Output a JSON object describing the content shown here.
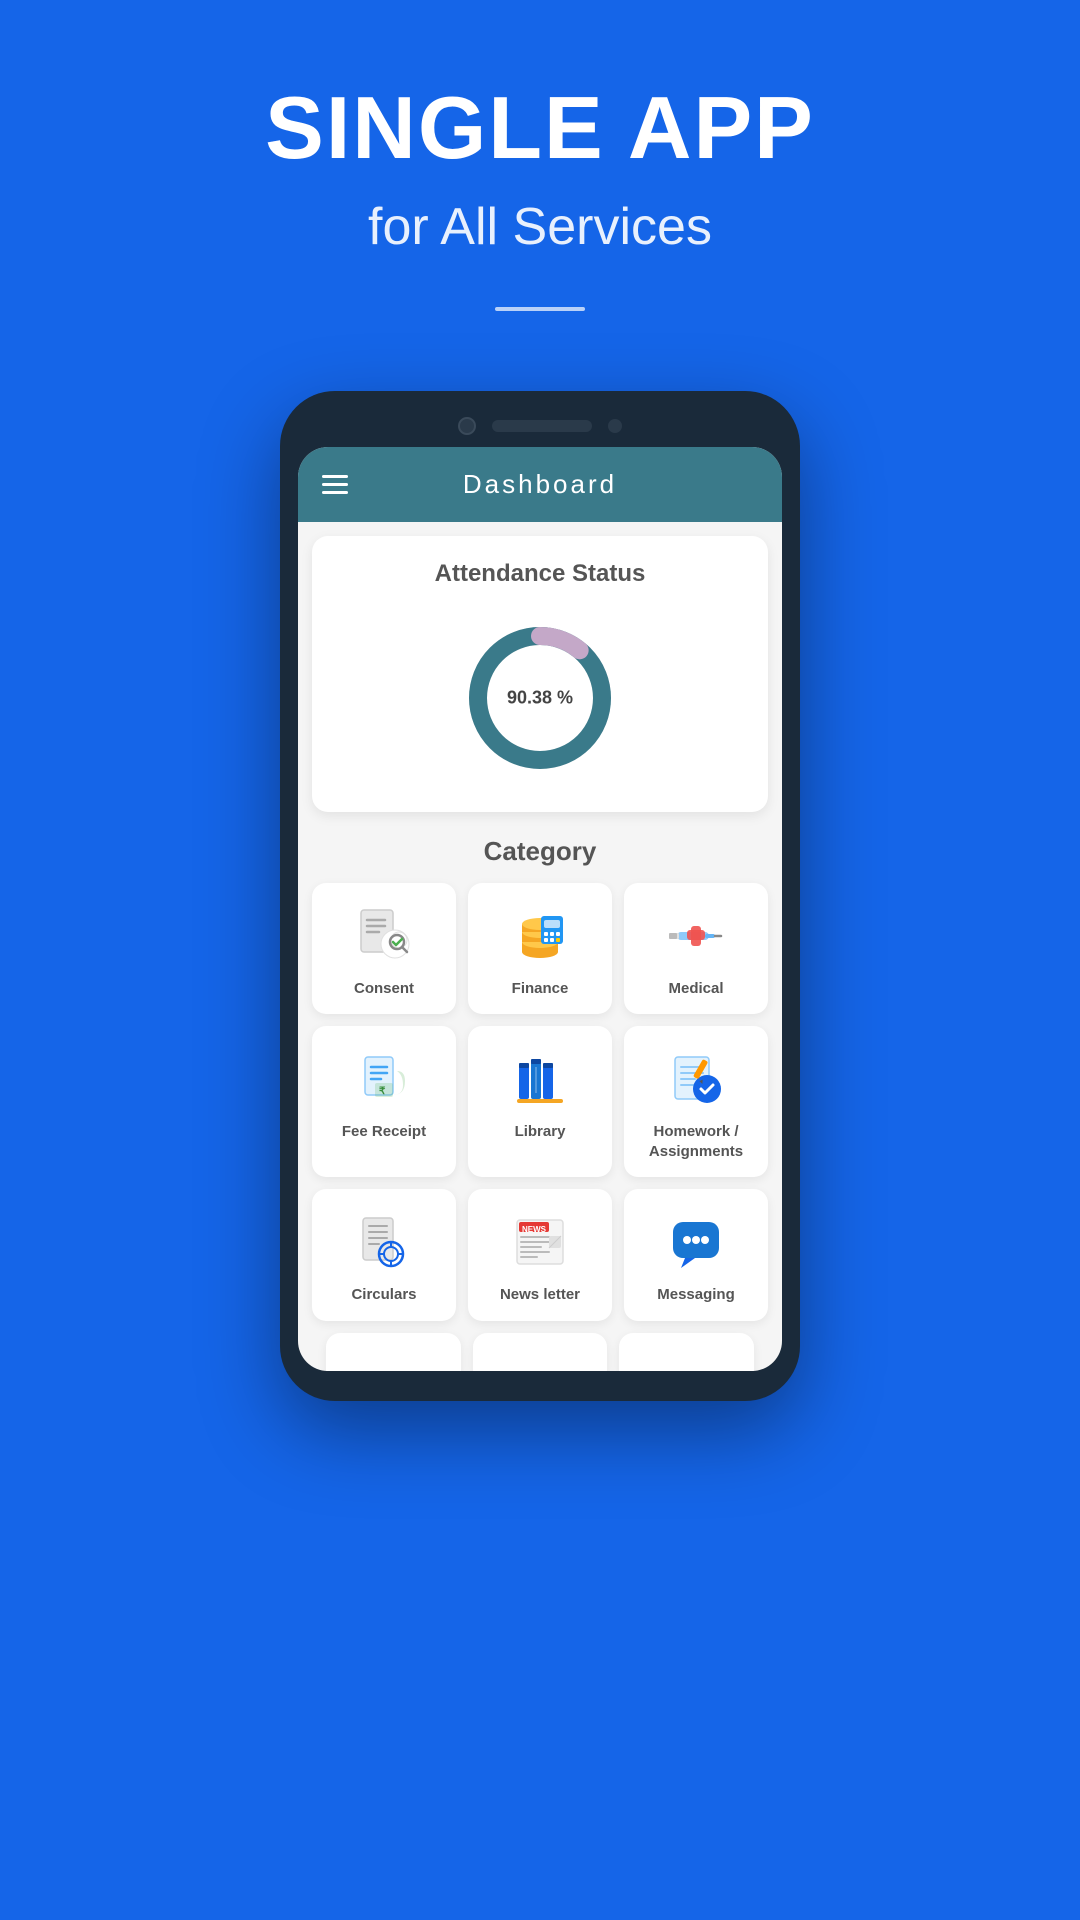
{
  "header": {
    "main_title": "SINGLE APP",
    "sub_title": "for All Services"
  },
  "phone": {
    "dashboard_title": "Dashboard"
  },
  "attendance": {
    "title": "Attendance Status",
    "percentage": "90.38 %",
    "value": 90.38
  },
  "category": {
    "title": "Category",
    "items": [
      {
        "id": "consent",
        "label": "Consent",
        "icon": "consent"
      },
      {
        "id": "finance",
        "label": "Finance",
        "icon": "finance"
      },
      {
        "id": "medical",
        "label": "Medical",
        "icon": "medical"
      },
      {
        "id": "fee-receipt",
        "label": "Fee Receipt",
        "icon": "fee-receipt"
      },
      {
        "id": "library",
        "label": "Library",
        "icon": "library"
      },
      {
        "id": "homework",
        "label": "Homework /\nAssignments",
        "icon": "homework"
      },
      {
        "id": "circulars",
        "label": "Circulars",
        "icon": "circulars"
      },
      {
        "id": "newsletter",
        "label": "News letter",
        "icon": "newsletter"
      },
      {
        "id": "messaging",
        "label": "Messaging",
        "icon": "messaging"
      }
    ]
  }
}
